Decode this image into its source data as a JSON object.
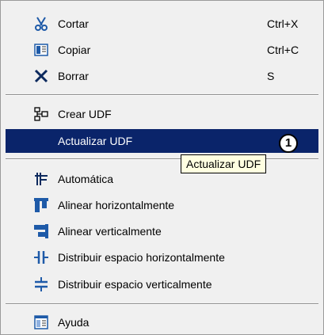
{
  "menu": {
    "items": [
      {
        "label": "Cortar",
        "shortcut": "Ctrl+X",
        "icon": "scissors-icon"
      },
      {
        "label": "Copiar",
        "shortcut": "Ctrl+C",
        "icon": "copy-icon"
      },
      {
        "label": "Borrar",
        "shortcut": "S",
        "icon": "delete-x-icon"
      },
      {
        "label": "Crear UDF",
        "icon": "create-udf-icon"
      },
      {
        "label": "Actualizar  UDF",
        "selected": true
      },
      {
        "label": "Automática",
        "icon": "auto-layout-icon"
      },
      {
        "label": "Alinear horizontalmente",
        "icon": "align-horizontal-icon"
      },
      {
        "label": "Alinear verticalmente",
        "icon": "align-vertical-icon"
      },
      {
        "label": "Distribuir espacio horizontalmente",
        "icon": "distribute-horizontal-icon"
      },
      {
        "label": "Distribuir espacio verticalmente",
        "icon": "distribute-vertical-icon"
      },
      {
        "label": "Ayuda",
        "icon": "help-document-icon"
      }
    ]
  },
  "tooltip": {
    "text": "Actualizar  UDF"
  },
  "badge": {
    "text": "1"
  },
  "colors": {
    "selection": "#0a246a",
    "menu_background": "#f0f0f0",
    "tooltip_background": "#ffffe1",
    "icon_blue": "#1e5aa8"
  }
}
